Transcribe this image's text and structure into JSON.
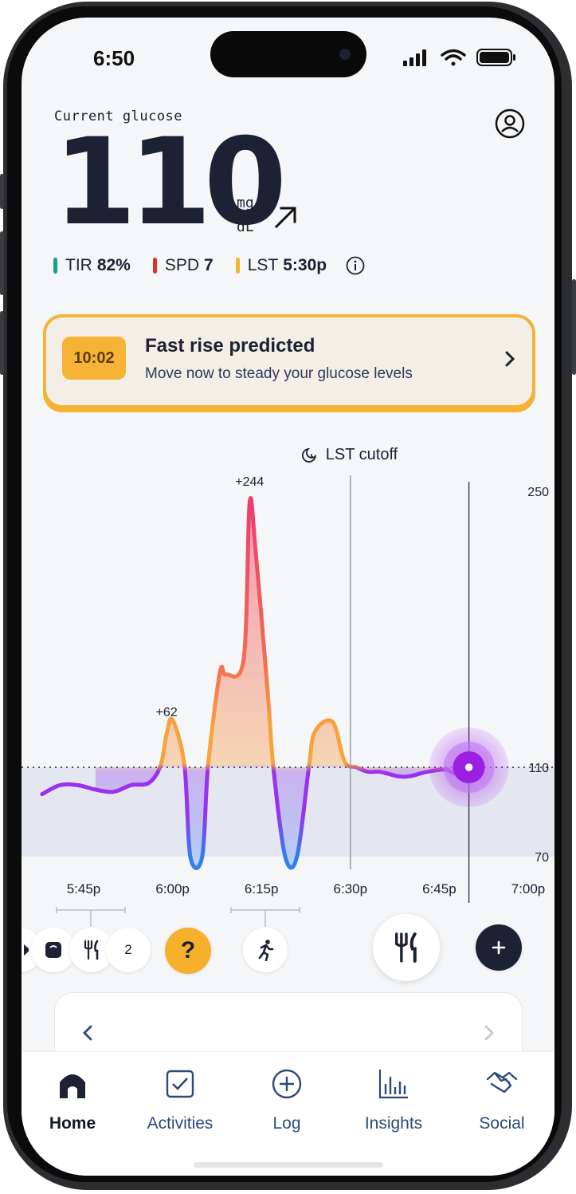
{
  "status_bar": {
    "time": "6:50"
  },
  "header": {
    "label": "Current glucose",
    "value": "110",
    "unit_top": "mg",
    "unit_bottom": "dL",
    "trend_icon": "arrow-up-right-icon",
    "profile_icon": "user-circle-icon"
  },
  "stats": [
    {
      "name": "TIR",
      "value": "82%",
      "color": "#12a38a"
    },
    {
      "name": "SPD",
      "value": "7",
      "color": "#e0322c"
    },
    {
      "name": "LST",
      "value": "5:30p",
      "color": "#f5b335"
    }
  ],
  "alert": {
    "timer": "10:02",
    "title": "Fast rise predicted",
    "subtitle": "Move now to steady your glucose levels"
  },
  "chart_data": {
    "type": "line",
    "title": "",
    "xlabel": "",
    "ylabel": "",
    "x_ticks": [
      "5:45p",
      "6:00p",
      "6:15p",
      "6:30p",
      "6:45p",
      "7:00p"
    ],
    "y_ticks": [
      250,
      110,
      70
    ],
    "target_line": 110,
    "cutoff_label": "LST cutoff",
    "cutoff_time": "6:30p",
    "annotations": [
      {
        "label": "+62",
        "x": "5:59p"
      },
      {
        "label": "+244",
        "x": "6:13p"
      }
    ],
    "series": [
      {
        "x": [
          "5:38p",
          "5:41p",
          "5:44p",
          "5:47p",
          "5:50p",
          "5:53p",
          "5:56p",
          "5:58p",
          "5:59p",
          "6:00p",
          "6:02p",
          "6:03p",
          "6:05p",
          "6:06p",
          "6:08p",
          "6:09p",
          "6:12p",
          "6:13p",
          "6:14p",
          "6:16p",
          "6:17p",
          "6:19p",
          "6:21p",
          "6:23p",
          "6:24p",
          "6:27p",
          "6:29p",
          "6:31p",
          "6:33p",
          "6:35p",
          "6:38p",
          "6:40p",
          "6:43p",
          "6:46p",
          "6:48p",
          "6:50p"
        ],
        "y": [
          98,
          102,
          102,
          100,
          99,
          102,
          103,
          111,
          127,
          134,
          111,
          70,
          70,
          111,
          158,
          157,
          165,
          244,
          220,
          150,
          110,
          70,
          70,
          110,
          128,
          133,
          113,
          110,
          108,
          108,
          106,
          106,
          108,
          109,
          107,
          110
        ]
      }
    ],
    "colors": {
      "low": "#2f80ed",
      "in_range": "#9b30f0",
      "mid": "#f8a33a",
      "high": "#ee3d6e"
    }
  },
  "action_row": {
    "count_badge": "2",
    "help_symbol": "?"
  },
  "card": {},
  "tabs": [
    {
      "label": "Home",
      "icon": "home-icon",
      "active": true
    },
    {
      "label": "Activities",
      "icon": "checkbox-icon",
      "active": false
    },
    {
      "label": "Log",
      "icon": "plus-circle-icon",
      "active": false
    },
    {
      "label": "Insights",
      "icon": "bar-chart-icon",
      "active": false
    },
    {
      "label": "Social",
      "icon": "handshake-icon",
      "active": false
    }
  ]
}
